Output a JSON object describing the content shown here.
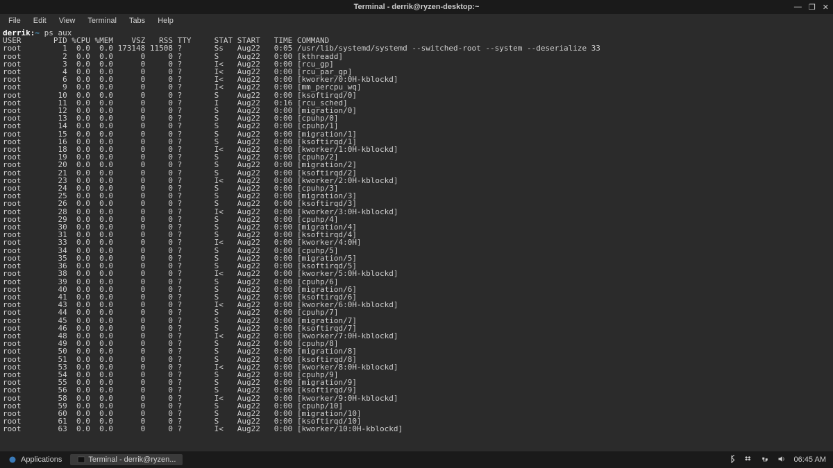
{
  "window": {
    "title": "Terminal - derrik@ryzen-desktop:~",
    "controls": {
      "min": "—",
      "max": "❐",
      "close": "✕"
    }
  },
  "menubar": [
    "File",
    "Edit",
    "View",
    "Terminal",
    "Tabs",
    "Help"
  ],
  "prompt": {
    "user": "derrik",
    "sep": ":",
    "path": "~",
    "cmd": "ps aux"
  },
  "header": {
    "user": "USER",
    "pid": "PID",
    "cpu": "%CPU",
    "mem": "%MEM",
    "vsz": "VSZ",
    "rss": "RSS",
    "tty": "TTY",
    "stat": "STAT",
    "start": "START",
    "time": "TIME",
    "command": "COMMAND"
  },
  "rows": [
    {
      "user": "root",
      "pid": "1",
      "cpu": "0.0",
      "mem": "0.0",
      "vsz": "173148",
      "rss": "11508",
      "tty": "?",
      "stat": "Ss",
      "start": "Aug22",
      "time": "0:05",
      "cmd": "/usr/lib/systemd/systemd --switched-root --system --deserialize 33"
    },
    {
      "user": "root",
      "pid": "2",
      "cpu": "0.0",
      "mem": "0.0",
      "vsz": "0",
      "rss": "0",
      "tty": "?",
      "stat": "S",
      "start": "Aug22",
      "time": "0:00",
      "cmd": "[kthreadd]"
    },
    {
      "user": "root",
      "pid": "3",
      "cpu": "0.0",
      "mem": "0.0",
      "vsz": "0",
      "rss": "0",
      "tty": "?",
      "stat": "I<",
      "start": "Aug22",
      "time": "0:00",
      "cmd": "[rcu_gp]"
    },
    {
      "user": "root",
      "pid": "4",
      "cpu": "0.0",
      "mem": "0.0",
      "vsz": "0",
      "rss": "0",
      "tty": "?",
      "stat": "I<",
      "start": "Aug22",
      "time": "0:00",
      "cmd": "[rcu_par_gp]"
    },
    {
      "user": "root",
      "pid": "6",
      "cpu": "0.0",
      "mem": "0.0",
      "vsz": "0",
      "rss": "0",
      "tty": "?",
      "stat": "I<",
      "start": "Aug22",
      "time": "0:00",
      "cmd": "[kworker/0:0H-kblockd]"
    },
    {
      "user": "root",
      "pid": "9",
      "cpu": "0.0",
      "mem": "0.0",
      "vsz": "0",
      "rss": "0",
      "tty": "?",
      "stat": "I<",
      "start": "Aug22",
      "time": "0:00",
      "cmd": "[mm_percpu_wq]"
    },
    {
      "user": "root",
      "pid": "10",
      "cpu": "0.0",
      "mem": "0.0",
      "vsz": "0",
      "rss": "0",
      "tty": "?",
      "stat": "S",
      "start": "Aug22",
      "time": "0:00",
      "cmd": "[ksoftirqd/0]"
    },
    {
      "user": "root",
      "pid": "11",
      "cpu": "0.0",
      "mem": "0.0",
      "vsz": "0",
      "rss": "0",
      "tty": "?",
      "stat": "I",
      "start": "Aug22",
      "time": "0:16",
      "cmd": "[rcu_sched]"
    },
    {
      "user": "root",
      "pid": "12",
      "cpu": "0.0",
      "mem": "0.0",
      "vsz": "0",
      "rss": "0",
      "tty": "?",
      "stat": "S",
      "start": "Aug22",
      "time": "0:00",
      "cmd": "[migration/0]"
    },
    {
      "user": "root",
      "pid": "13",
      "cpu": "0.0",
      "mem": "0.0",
      "vsz": "0",
      "rss": "0",
      "tty": "?",
      "stat": "S",
      "start": "Aug22",
      "time": "0:00",
      "cmd": "[cpuhp/0]"
    },
    {
      "user": "root",
      "pid": "14",
      "cpu": "0.0",
      "mem": "0.0",
      "vsz": "0",
      "rss": "0",
      "tty": "?",
      "stat": "S",
      "start": "Aug22",
      "time": "0:00",
      "cmd": "[cpuhp/1]"
    },
    {
      "user": "root",
      "pid": "15",
      "cpu": "0.0",
      "mem": "0.0",
      "vsz": "0",
      "rss": "0",
      "tty": "?",
      "stat": "S",
      "start": "Aug22",
      "time": "0:00",
      "cmd": "[migration/1]"
    },
    {
      "user": "root",
      "pid": "16",
      "cpu": "0.0",
      "mem": "0.0",
      "vsz": "0",
      "rss": "0",
      "tty": "?",
      "stat": "S",
      "start": "Aug22",
      "time": "0:00",
      "cmd": "[ksoftirqd/1]"
    },
    {
      "user": "root",
      "pid": "18",
      "cpu": "0.0",
      "mem": "0.0",
      "vsz": "0",
      "rss": "0",
      "tty": "?",
      "stat": "I<",
      "start": "Aug22",
      "time": "0:00",
      "cmd": "[kworker/1:0H-kblockd]"
    },
    {
      "user": "root",
      "pid": "19",
      "cpu": "0.0",
      "mem": "0.0",
      "vsz": "0",
      "rss": "0",
      "tty": "?",
      "stat": "S",
      "start": "Aug22",
      "time": "0:00",
      "cmd": "[cpuhp/2]"
    },
    {
      "user": "root",
      "pid": "20",
      "cpu": "0.0",
      "mem": "0.0",
      "vsz": "0",
      "rss": "0",
      "tty": "?",
      "stat": "S",
      "start": "Aug22",
      "time": "0:00",
      "cmd": "[migration/2]"
    },
    {
      "user": "root",
      "pid": "21",
      "cpu": "0.0",
      "mem": "0.0",
      "vsz": "0",
      "rss": "0",
      "tty": "?",
      "stat": "S",
      "start": "Aug22",
      "time": "0:00",
      "cmd": "[ksoftirqd/2]"
    },
    {
      "user": "root",
      "pid": "23",
      "cpu": "0.0",
      "mem": "0.0",
      "vsz": "0",
      "rss": "0",
      "tty": "?",
      "stat": "I<",
      "start": "Aug22",
      "time": "0:00",
      "cmd": "[kworker/2:0H-kblockd]"
    },
    {
      "user": "root",
      "pid": "24",
      "cpu": "0.0",
      "mem": "0.0",
      "vsz": "0",
      "rss": "0",
      "tty": "?",
      "stat": "S",
      "start": "Aug22",
      "time": "0:00",
      "cmd": "[cpuhp/3]"
    },
    {
      "user": "root",
      "pid": "25",
      "cpu": "0.0",
      "mem": "0.0",
      "vsz": "0",
      "rss": "0",
      "tty": "?",
      "stat": "S",
      "start": "Aug22",
      "time": "0:00",
      "cmd": "[migration/3]"
    },
    {
      "user": "root",
      "pid": "26",
      "cpu": "0.0",
      "mem": "0.0",
      "vsz": "0",
      "rss": "0",
      "tty": "?",
      "stat": "S",
      "start": "Aug22",
      "time": "0:00",
      "cmd": "[ksoftirqd/3]"
    },
    {
      "user": "root",
      "pid": "28",
      "cpu": "0.0",
      "mem": "0.0",
      "vsz": "0",
      "rss": "0",
      "tty": "?",
      "stat": "I<",
      "start": "Aug22",
      "time": "0:00",
      "cmd": "[kworker/3:0H-kblockd]"
    },
    {
      "user": "root",
      "pid": "29",
      "cpu": "0.0",
      "mem": "0.0",
      "vsz": "0",
      "rss": "0",
      "tty": "?",
      "stat": "S",
      "start": "Aug22",
      "time": "0:00",
      "cmd": "[cpuhp/4]"
    },
    {
      "user": "root",
      "pid": "30",
      "cpu": "0.0",
      "mem": "0.0",
      "vsz": "0",
      "rss": "0",
      "tty": "?",
      "stat": "S",
      "start": "Aug22",
      "time": "0:00",
      "cmd": "[migration/4]"
    },
    {
      "user": "root",
      "pid": "31",
      "cpu": "0.0",
      "mem": "0.0",
      "vsz": "0",
      "rss": "0",
      "tty": "?",
      "stat": "S",
      "start": "Aug22",
      "time": "0:00",
      "cmd": "[ksoftirqd/4]"
    },
    {
      "user": "root",
      "pid": "33",
      "cpu": "0.0",
      "mem": "0.0",
      "vsz": "0",
      "rss": "0",
      "tty": "?",
      "stat": "I<",
      "start": "Aug22",
      "time": "0:00",
      "cmd": "[kworker/4:0H]"
    },
    {
      "user": "root",
      "pid": "34",
      "cpu": "0.0",
      "mem": "0.0",
      "vsz": "0",
      "rss": "0",
      "tty": "?",
      "stat": "S",
      "start": "Aug22",
      "time": "0:00",
      "cmd": "[cpuhp/5]"
    },
    {
      "user": "root",
      "pid": "35",
      "cpu": "0.0",
      "mem": "0.0",
      "vsz": "0",
      "rss": "0",
      "tty": "?",
      "stat": "S",
      "start": "Aug22",
      "time": "0:00",
      "cmd": "[migration/5]"
    },
    {
      "user": "root",
      "pid": "36",
      "cpu": "0.0",
      "mem": "0.0",
      "vsz": "0",
      "rss": "0",
      "tty": "?",
      "stat": "S",
      "start": "Aug22",
      "time": "0:00",
      "cmd": "[ksoftirqd/5]"
    },
    {
      "user": "root",
      "pid": "38",
      "cpu": "0.0",
      "mem": "0.0",
      "vsz": "0",
      "rss": "0",
      "tty": "?",
      "stat": "I<",
      "start": "Aug22",
      "time": "0:00",
      "cmd": "[kworker/5:0H-kblockd]"
    },
    {
      "user": "root",
      "pid": "39",
      "cpu": "0.0",
      "mem": "0.0",
      "vsz": "0",
      "rss": "0",
      "tty": "?",
      "stat": "S",
      "start": "Aug22",
      "time": "0:00",
      "cmd": "[cpuhp/6]"
    },
    {
      "user": "root",
      "pid": "40",
      "cpu": "0.0",
      "mem": "0.0",
      "vsz": "0",
      "rss": "0",
      "tty": "?",
      "stat": "S",
      "start": "Aug22",
      "time": "0:00",
      "cmd": "[migration/6]"
    },
    {
      "user": "root",
      "pid": "41",
      "cpu": "0.0",
      "mem": "0.0",
      "vsz": "0",
      "rss": "0",
      "tty": "?",
      "stat": "S",
      "start": "Aug22",
      "time": "0:00",
      "cmd": "[ksoftirqd/6]"
    },
    {
      "user": "root",
      "pid": "43",
      "cpu": "0.0",
      "mem": "0.0",
      "vsz": "0",
      "rss": "0",
      "tty": "?",
      "stat": "I<",
      "start": "Aug22",
      "time": "0:00",
      "cmd": "[kworker/6:0H-kblockd]"
    },
    {
      "user": "root",
      "pid": "44",
      "cpu": "0.0",
      "mem": "0.0",
      "vsz": "0",
      "rss": "0",
      "tty": "?",
      "stat": "S",
      "start": "Aug22",
      "time": "0:00",
      "cmd": "[cpuhp/7]"
    },
    {
      "user": "root",
      "pid": "45",
      "cpu": "0.0",
      "mem": "0.0",
      "vsz": "0",
      "rss": "0",
      "tty": "?",
      "stat": "S",
      "start": "Aug22",
      "time": "0:00",
      "cmd": "[migration/7]"
    },
    {
      "user": "root",
      "pid": "46",
      "cpu": "0.0",
      "mem": "0.0",
      "vsz": "0",
      "rss": "0",
      "tty": "?",
      "stat": "S",
      "start": "Aug22",
      "time": "0:00",
      "cmd": "[ksoftirqd/7]"
    },
    {
      "user": "root",
      "pid": "48",
      "cpu": "0.0",
      "mem": "0.0",
      "vsz": "0",
      "rss": "0",
      "tty": "?",
      "stat": "I<",
      "start": "Aug22",
      "time": "0:00",
      "cmd": "[kworker/7:0H-kblockd]"
    },
    {
      "user": "root",
      "pid": "49",
      "cpu": "0.0",
      "mem": "0.0",
      "vsz": "0",
      "rss": "0",
      "tty": "?",
      "stat": "S",
      "start": "Aug22",
      "time": "0:00",
      "cmd": "[cpuhp/8]"
    },
    {
      "user": "root",
      "pid": "50",
      "cpu": "0.0",
      "mem": "0.0",
      "vsz": "0",
      "rss": "0",
      "tty": "?",
      "stat": "S",
      "start": "Aug22",
      "time": "0:00",
      "cmd": "[migration/8]"
    },
    {
      "user": "root",
      "pid": "51",
      "cpu": "0.0",
      "mem": "0.0",
      "vsz": "0",
      "rss": "0",
      "tty": "?",
      "stat": "S",
      "start": "Aug22",
      "time": "0:00",
      "cmd": "[ksoftirqd/8]"
    },
    {
      "user": "root",
      "pid": "53",
      "cpu": "0.0",
      "mem": "0.0",
      "vsz": "0",
      "rss": "0",
      "tty": "?",
      "stat": "I<",
      "start": "Aug22",
      "time": "0:00",
      "cmd": "[kworker/8:0H-kblockd]"
    },
    {
      "user": "root",
      "pid": "54",
      "cpu": "0.0",
      "mem": "0.0",
      "vsz": "0",
      "rss": "0",
      "tty": "?",
      "stat": "S",
      "start": "Aug22",
      "time": "0:00",
      "cmd": "[cpuhp/9]"
    },
    {
      "user": "root",
      "pid": "55",
      "cpu": "0.0",
      "mem": "0.0",
      "vsz": "0",
      "rss": "0",
      "tty": "?",
      "stat": "S",
      "start": "Aug22",
      "time": "0:00",
      "cmd": "[migration/9]"
    },
    {
      "user": "root",
      "pid": "56",
      "cpu": "0.0",
      "mem": "0.0",
      "vsz": "0",
      "rss": "0",
      "tty": "?",
      "stat": "S",
      "start": "Aug22",
      "time": "0:00",
      "cmd": "[ksoftirqd/9]"
    },
    {
      "user": "root",
      "pid": "58",
      "cpu": "0.0",
      "mem": "0.0",
      "vsz": "0",
      "rss": "0",
      "tty": "?",
      "stat": "I<",
      "start": "Aug22",
      "time": "0:00",
      "cmd": "[kworker/9:0H-kblockd]"
    },
    {
      "user": "root",
      "pid": "59",
      "cpu": "0.0",
      "mem": "0.0",
      "vsz": "0",
      "rss": "0",
      "tty": "?",
      "stat": "S",
      "start": "Aug22",
      "time": "0:00",
      "cmd": "[cpuhp/10]"
    },
    {
      "user": "root",
      "pid": "60",
      "cpu": "0.0",
      "mem": "0.0",
      "vsz": "0",
      "rss": "0",
      "tty": "?",
      "stat": "S",
      "start": "Aug22",
      "time": "0:00",
      "cmd": "[migration/10]"
    },
    {
      "user": "root",
      "pid": "61",
      "cpu": "0.0",
      "mem": "0.0",
      "vsz": "0",
      "rss": "0",
      "tty": "?",
      "stat": "S",
      "start": "Aug22",
      "time": "0:00",
      "cmd": "[ksoftirqd/10]"
    },
    {
      "user": "root",
      "pid": "63",
      "cpu": "0.0",
      "mem": "0.0",
      "vsz": "0",
      "rss": "0",
      "tty": "?",
      "stat": "I<",
      "start": "Aug22",
      "time": "0:00",
      "cmd": "[kworker/10:0H-kblockd]"
    }
  ],
  "taskbar": {
    "applications": "Applications",
    "task": "Terminal - derrik@ryzen...",
    "clock": "06:45 AM"
  }
}
